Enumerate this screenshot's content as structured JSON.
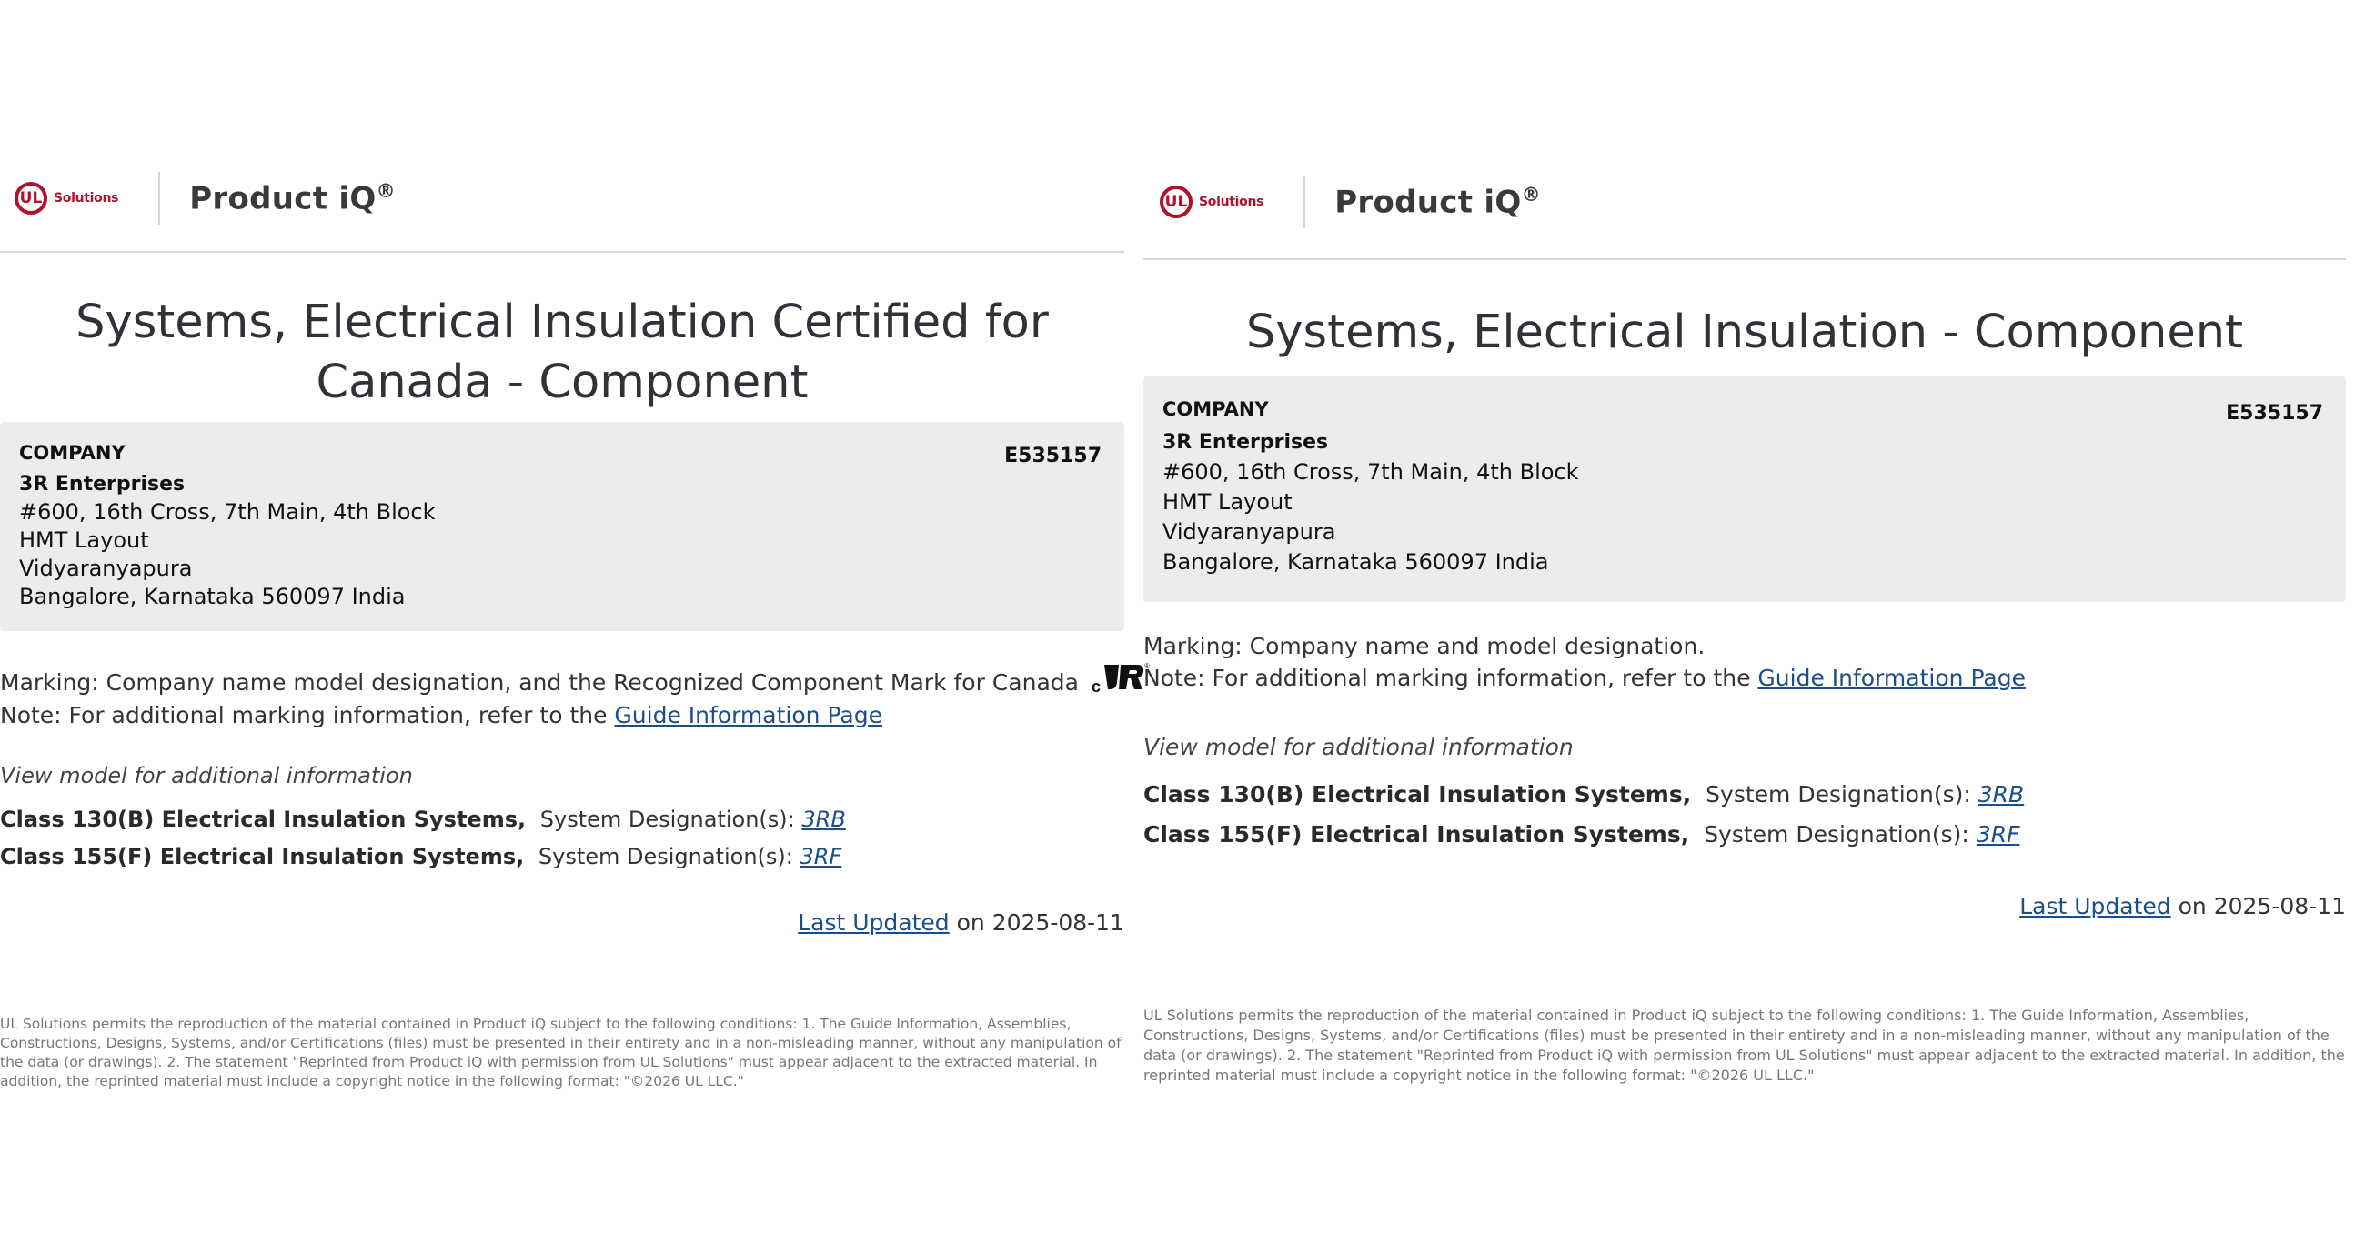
{
  "brand": {
    "logo_mark": "UL",
    "logo_text": "Solutions",
    "app_title": "Product iQ",
    "app_title_sup": "®",
    "brand_color": "#b0112c"
  },
  "labels": {
    "company": "COMPANY",
    "marking_prefix": "Note: For additional marking information, refer to the ",
    "guide_link": "Guide Information Page",
    "view_hint": "View model for additional information",
    "system_designation": "System Designation(s): ",
    "last_updated_link": "Last Updated",
    "last_updated_on": " on 2025-08-11",
    "permission": "UL Solutions permits the reproduction of the material contained in Product iQ subject to the following conditions: 1. The Guide Information, Assemblies, Constructions, Designs, Systems, and/or Certifications (files) must be presented in their entirety and in a non-misleading manner, without any manipulation of the data (or drawings). 2. The statement \"Reprinted from Product iQ with permission from UL Solutions\" must appear adjacent to the extracted material. In addition, the reprinted material must include a copyright notice in the following format: \"©2026 UL LLC.\""
  },
  "company": {
    "file_number": "E535157",
    "name": "3R Enterprises",
    "address": [
      "#600, 16th Cross, 7th Main, 4th Block",
      "HMT Layout",
      "Vidyaranyapura",
      "Bangalore, Karnataka 560097 India"
    ]
  },
  "models": [
    {
      "class": "Class 130(B) Electrical Insulation Systems,",
      "designation": "3RB"
    },
    {
      "class": "Class 155(F) Electrical Insulation Systems,",
      "designation": "3RF"
    }
  ],
  "pages": [
    {
      "title": "Systems, Electrical Insulation Certified for Canada - Component",
      "marking": "Marking: Company name model designation, and the Recognized Component Mark for Canada",
      "mark_icon": "ur-canada-recognized-mark"
    },
    {
      "title": "Systems, Electrical Insulation - Component",
      "marking": "Marking: Company name and model designation."
    }
  ]
}
